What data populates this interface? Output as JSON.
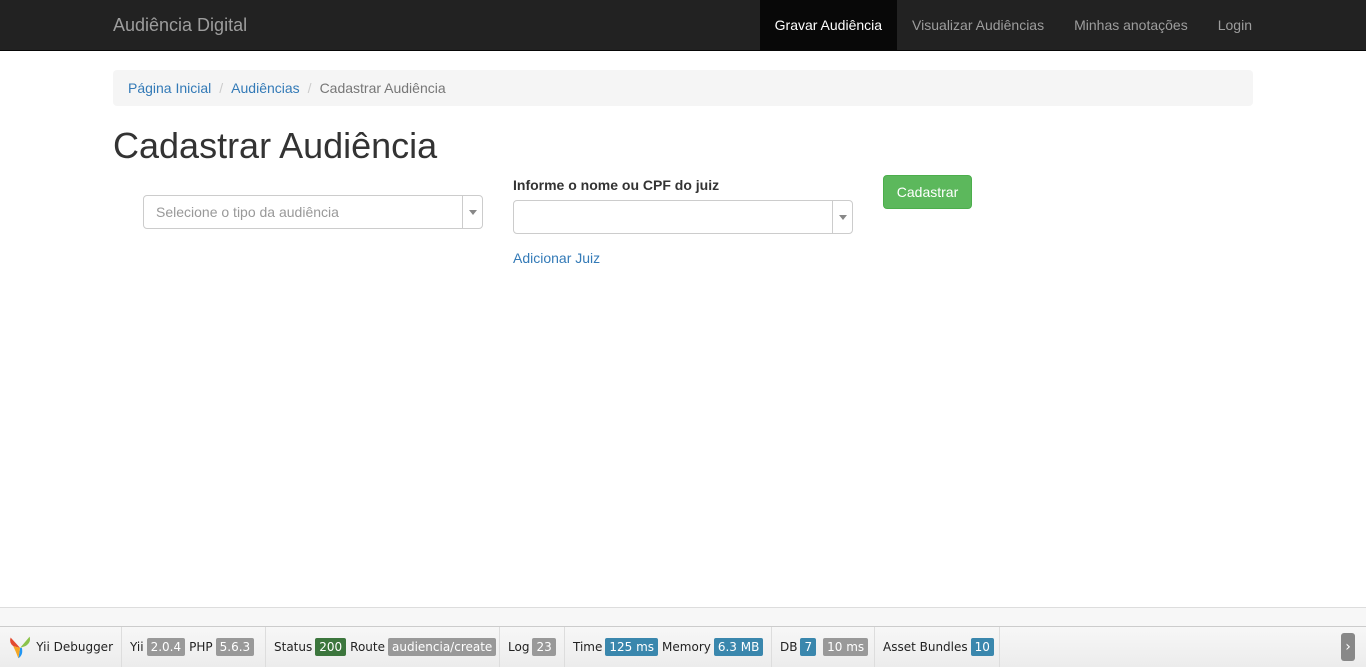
{
  "navbar": {
    "brand": "Audiência Digital",
    "items": [
      {
        "label": "Gravar Audiência",
        "active": true
      },
      {
        "label": "Visualizar Audiências",
        "active": false
      },
      {
        "label": "Minhas anotações",
        "active": false
      },
      {
        "label": "Login",
        "active": false
      }
    ]
  },
  "breadcrumb": {
    "items": [
      "Página Inicial",
      "Audiências"
    ],
    "separator": "/",
    "current": "Cadastrar Audiência"
  },
  "page": {
    "title": "Cadastrar Audiência"
  },
  "form": {
    "tipo_placeholder": "Selecione o tipo da audiência",
    "juiz_label": "Informe o nome ou CPF do juiz",
    "juiz_value": "",
    "add_juiz_link": "Adicionar Juiz",
    "submit_label": "Cadastrar"
  },
  "debugger": {
    "title": "Yii Debugger",
    "yii_label": "Yii",
    "yii_version": "2.0.4",
    "php_label": "PHP",
    "php_version": "5.6.3",
    "status_label": "Status",
    "status_value": "200",
    "route_label": "Route",
    "route_value": "audiencia/create",
    "log_label": "Log",
    "log_value": "23",
    "time_label": "Time",
    "time_value": "125 ms",
    "memory_label": "Memory",
    "memory_value": "6.3 MB",
    "db_label": "DB",
    "db_count": "7",
    "db_time": "10 ms",
    "bundles_label": "Asset Bundles",
    "bundles_value": "10",
    "toggle_icon": "chevron-right-icon"
  },
  "colors": {
    "navbar_bg": "#222222",
    "link": "#337ab7",
    "success": "#5cb85c"
  }
}
